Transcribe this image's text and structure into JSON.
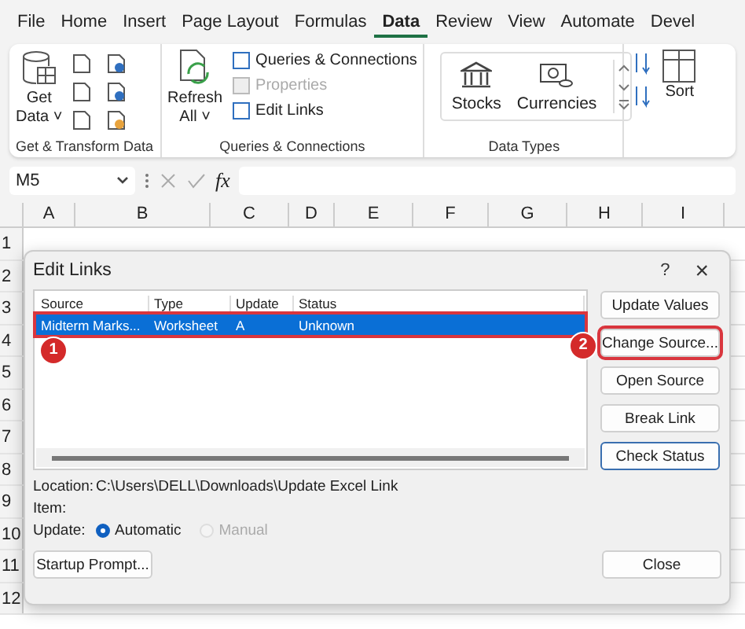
{
  "menu_tabs": [
    {
      "label": "File",
      "selected": false
    },
    {
      "label": "Home",
      "selected": false
    },
    {
      "label": "Insert",
      "selected": false
    },
    {
      "label": "Page Layout",
      "selected": false
    },
    {
      "label": "Formulas",
      "selected": false
    },
    {
      "label": "Data",
      "selected": true
    },
    {
      "label": "Review",
      "selected": false
    },
    {
      "label": "View",
      "selected": false
    },
    {
      "label": "Automate",
      "selected": false
    },
    {
      "label": "Devel",
      "selected": false
    }
  ],
  "ribbon": {
    "get_transform": {
      "button": [
        "Get",
        "Data ˅"
      ],
      "label": "Get & Transform Data"
    },
    "queries": {
      "refresh": [
        "Refresh",
        "All ˅"
      ],
      "items": [
        {
          "label": "Queries & Connections",
          "disabled": false
        },
        {
          "label": "Properties",
          "disabled": true
        },
        {
          "label": "Edit Links",
          "disabled": false
        }
      ],
      "label": "Queries & Connections"
    },
    "data_types": {
      "items": [
        "Stocks",
        "Currencies"
      ],
      "label": "Data Types"
    },
    "sort": {
      "label": "Sort"
    }
  },
  "formula_bar": {
    "name_box": "M5",
    "fx": "fx"
  },
  "sheet": {
    "columns": [
      "A",
      "B",
      "C",
      "D",
      "E",
      "F",
      "G",
      "H",
      "I"
    ],
    "rows": [
      "1",
      "2",
      "3",
      "4",
      "5",
      "6",
      "7",
      "8",
      "9",
      "10",
      "11",
      "12"
    ]
  },
  "dialog": {
    "title": "Edit Links",
    "help": "?",
    "close": "×",
    "columns": [
      "Source",
      "Type",
      "Update",
      "Status"
    ],
    "links": [
      {
        "cells": [
          "Midterm Marks...",
          "Worksheet",
          "A",
          "Unknown"
        ],
        "selected": true
      }
    ],
    "buttons": [
      {
        "label": "Update Values",
        "focused": false,
        "annotated": false
      },
      {
        "label": "Change Source...",
        "focused": false,
        "annotated": true
      },
      {
        "label": "Open Source",
        "focused": false,
        "annotated": false
      },
      {
        "label": "Break Link",
        "focused": false,
        "annotated": false
      },
      {
        "label": "Check Status",
        "focused": true,
        "annotated": false
      }
    ],
    "location_label": "Location:",
    "location": "C:\\Users\\DELL\\Downloads\\Update Excel Link",
    "item_label": "Item:",
    "update_label": "Update:",
    "update_options": [
      {
        "label": "Automatic",
        "selected": true,
        "disabled": false
      },
      {
        "label": "Manual",
        "selected": false,
        "disabled": true
      }
    ],
    "startup": "Startup Prompt...",
    "close_button": "Close"
  },
  "annotations": [
    {
      "number": "1"
    },
    {
      "number": "2"
    }
  ]
}
